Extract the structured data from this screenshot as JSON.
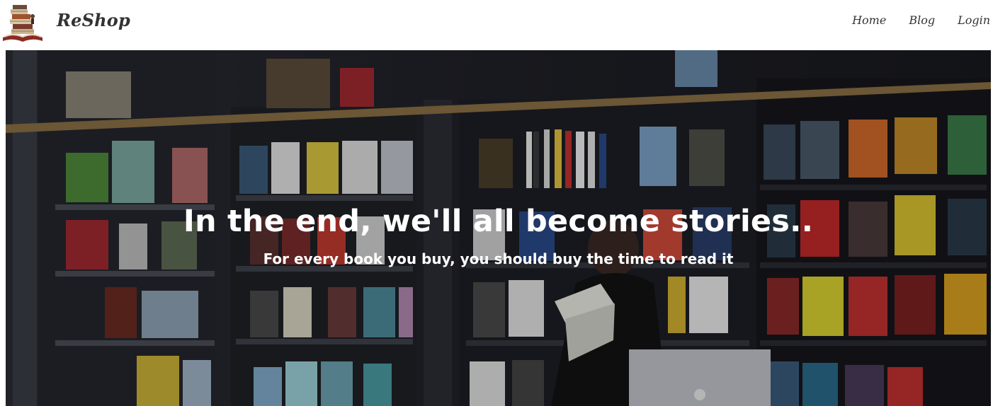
{
  "header": {
    "brand_name": "ReShop",
    "logo_icon": "book-stack-logo",
    "nav": [
      {
        "label": "Home"
      },
      {
        "label": "Blog"
      },
      {
        "label": "Login"
      }
    ]
  },
  "hero": {
    "title": "In the end, we'll all become stories..",
    "subtitle": "For every book you buy, you should buy the time to read it",
    "background_image": "bookstore-shelves-woman-reading-photo"
  },
  "colors": {
    "nav_text": "#333333",
    "hero_text": "#ffffff",
    "hero_overlay": "#1c1c22"
  }
}
